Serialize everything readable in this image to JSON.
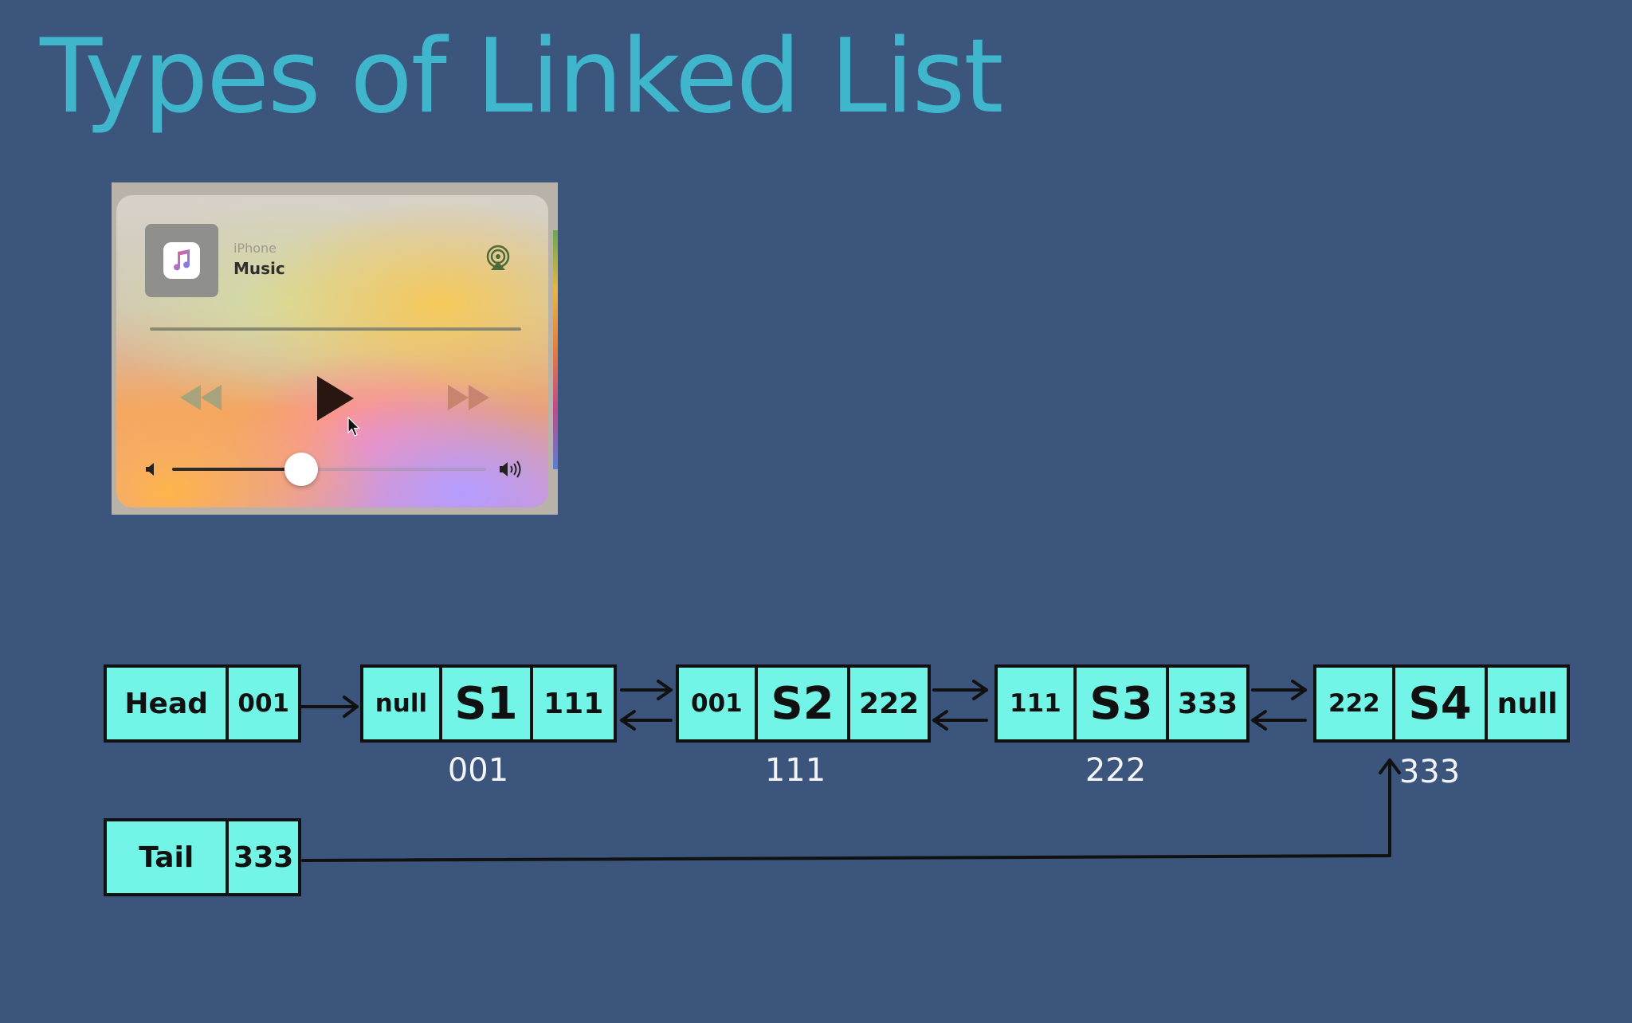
{
  "title": "Types of Linked List",
  "player": {
    "source": "iPhone",
    "app_name": "Music",
    "volume_level": 0.41,
    "icons": [
      "music-app-icon",
      "airplay-icon",
      "rewind-icon",
      "play-icon",
      "fast-forward-icon",
      "volume-low-icon",
      "volume-high-icon",
      "cursor-icon"
    ]
  },
  "head": {
    "label": "Head",
    "pointer": "001"
  },
  "tail": {
    "label": "Tail",
    "pointer": "333"
  },
  "nodes": [
    {
      "prev": "null",
      "value": "S1",
      "next": "111",
      "address": "001"
    },
    {
      "prev": "001",
      "value": "S2",
      "next": "222",
      "address": "111"
    },
    {
      "prev": "111",
      "value": "S3",
      "next": "333",
      "address": "222"
    },
    {
      "prev": "222",
      "value": "S4",
      "next": "null",
      "address": "333"
    }
  ],
  "colors": {
    "background": "#3c557d",
    "title": "#3fb6cc",
    "node_fill": "#72f5e6",
    "node_border": "#111111",
    "address_text": "#f2f4f8"
  }
}
